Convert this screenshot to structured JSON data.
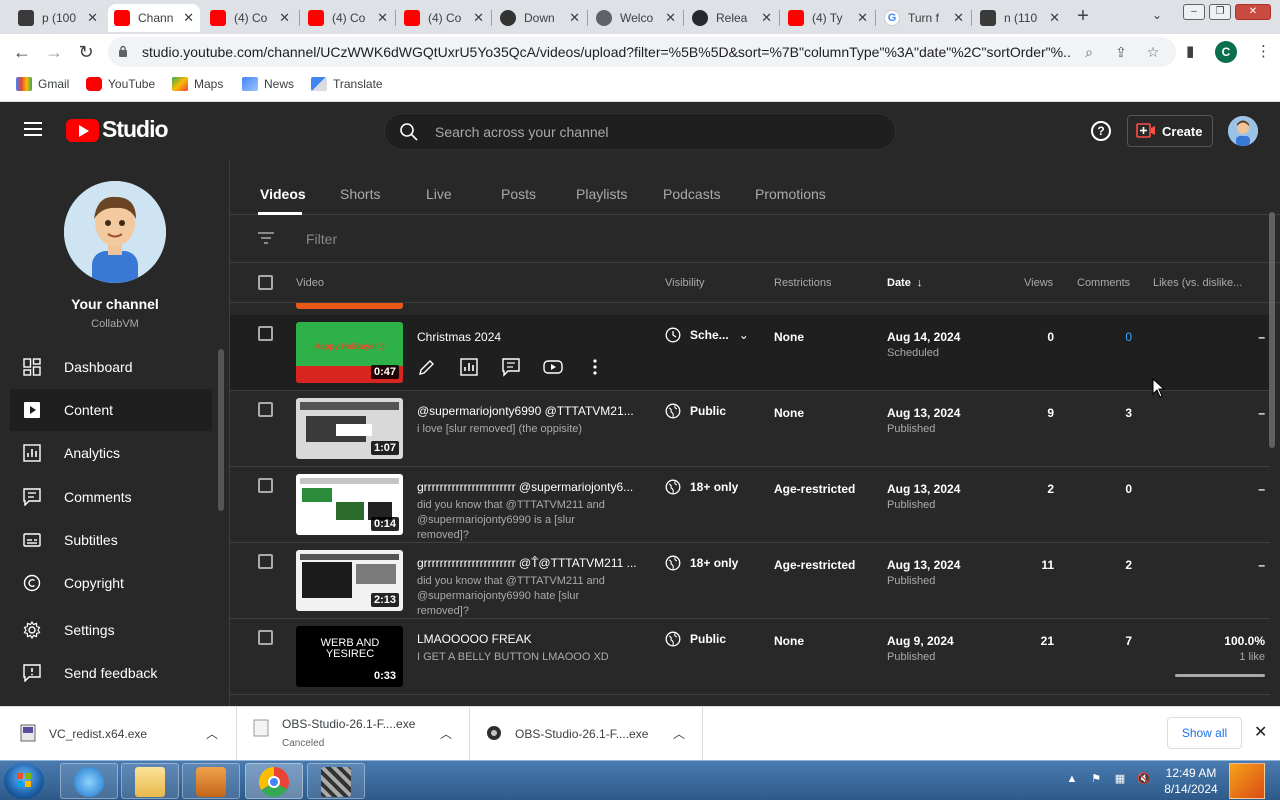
{
  "browser": {
    "tabs": [
      {
        "title": "p (100"
      },
      {
        "title": "Chann"
      },
      {
        "title": "(4) Co"
      },
      {
        "title": "(4) Co"
      },
      {
        "title": "(4) Co"
      },
      {
        "title": "Down"
      },
      {
        "title": "Welco"
      },
      {
        "title": "Relea"
      },
      {
        "title": "(4) Ty"
      },
      {
        "title": "Turn f"
      },
      {
        "title": "n (110"
      }
    ],
    "url": "studio.youtube.com/channel/UCzWWK6dWGQtUxrU5Yo35QcA/videos/upload?filter=%5B%5D&sort=%7B\"columnType\"%3A\"date\"%2C\"sortOrder\"%...",
    "profile_initial": "C",
    "bookmarks": [
      {
        "label": "Gmail"
      },
      {
        "label": "YouTube"
      },
      {
        "label": "Maps"
      },
      {
        "label": "News"
      },
      {
        "label": "Translate"
      }
    ]
  },
  "header": {
    "logo_text": "Studio",
    "search_placeholder": "Search across your channel",
    "help_glyph": "?",
    "create_label": "Create"
  },
  "sidebar": {
    "your_channel": "Your channel",
    "channel_name": "CollabVM",
    "items": [
      {
        "label": "Dashboard"
      },
      {
        "label": "Content"
      },
      {
        "label": "Analytics"
      },
      {
        "label": "Comments"
      },
      {
        "label": "Subtitles"
      },
      {
        "label": "Copyright"
      },
      {
        "label": "Settings"
      },
      {
        "label": "Send feedback"
      }
    ]
  },
  "content": {
    "tabs": [
      {
        "label": "Videos"
      },
      {
        "label": "Shorts"
      },
      {
        "label": "Live"
      },
      {
        "label": "Posts"
      },
      {
        "label": "Playlists"
      },
      {
        "label": "Podcasts"
      },
      {
        "label": "Promotions"
      }
    ],
    "filter_placeholder": "Filter",
    "columns": {
      "video": "Video",
      "visibility": "Visibility",
      "restrictions": "Restrictions",
      "date": "Date",
      "views": "Views",
      "comments": "Comments",
      "likes": "Likes (vs. dislike..."
    },
    "rows": [
      {
        "title": "Christmas 2024",
        "description": "",
        "duration": "0:47",
        "thumb_text": "Happy Holidays! :)",
        "visibility": "Sche...",
        "restrictions": "None",
        "date": "Aug 14, 2024",
        "status": "Scheduled",
        "views": "0",
        "comments": "0",
        "likes": "–",
        "likes_sub": ""
      },
      {
        "title": "@supermariojonty6990 @TTTATVM21...",
        "description": "i love [slur removed] (the oppisite)",
        "duration": "1:07",
        "thumb_text": "",
        "visibility": "Public",
        "restrictions": "None",
        "date": "Aug 13, 2024",
        "status": "Published",
        "views": "9",
        "comments": "3",
        "likes": "–",
        "likes_sub": ""
      },
      {
        "title": "grrrrrrrrrrrrrrrrrrrrrrr @supermariojonty6...",
        "description": "did you know that @TTTATVM211 and @supermariojonty6990 is a [slur removed]?",
        "duration": "0:14",
        "thumb_text": "",
        "visibility": "18+ only",
        "restrictions": "Age-restricted",
        "date": "Aug 13, 2024",
        "status": "Published",
        "views": "2",
        "comments": "0",
        "likes": "–",
        "likes_sub": ""
      },
      {
        "title": "grrrrrrrrrrrrrrrrrrrrrrr @T̂@TTTATVM211 ...",
        "description": "did you know that @TTTATVM211 and @supermariojonty6990 hate [slur removed]?",
        "duration": "2:13",
        "thumb_text": "",
        "visibility": "18+ only",
        "restrictions": "Age-restricted",
        "date": "Aug 13, 2024",
        "status": "Published",
        "views": "11",
        "comments": "2",
        "likes": "–",
        "likes_sub": ""
      },
      {
        "title": "LMAOOOOO FREAK",
        "description": "I GET A BELLY BUTTON LMAOOO XD",
        "duration": "0:33",
        "thumb_text": "WERB AND YESIREC",
        "visibility": "Public",
        "restrictions": "None",
        "date": "Aug 9, 2024",
        "status": "Published",
        "views": "21",
        "comments": "7",
        "likes": "100.0%",
        "likes_sub": "1 like",
        "likes_ratio": 1.0
      }
    ]
  },
  "downloads": [
    {
      "name": "VC_redist.x64.exe",
      "sub": ""
    },
    {
      "name": "OBS-Studio-26.1-F....exe",
      "sub": "Canceled"
    },
    {
      "name": "OBS-Studio-26.1-F....exe",
      "sub": ""
    }
  ],
  "downloads_show_all": "Show all",
  "taskbar": {
    "time": "12:49 AM",
    "date": "8/14/2024"
  },
  "colors": {
    "yt_red": "#ff0000",
    "link_blue": "#3ea6ff",
    "studio_bg": "#282828"
  }
}
